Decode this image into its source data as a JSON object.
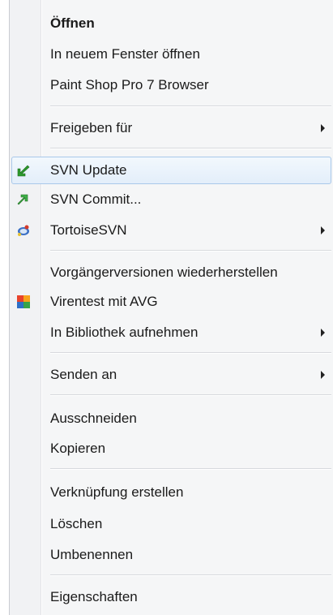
{
  "context_menu": {
    "items": [
      {
        "label": "Öffnen"
      },
      {
        "label": "In neuem Fenster öffnen"
      },
      {
        "label": "Paint Shop Pro 7 Browser"
      },
      {
        "label": "Freigeben für"
      },
      {
        "label": "SVN Update",
        "icon": "svn-update-icon"
      },
      {
        "label": "SVN Commit...",
        "icon": "svn-commit-icon"
      },
      {
        "label": "TortoiseSVN",
        "icon": "tortoisesvn-icon"
      },
      {
        "label": "Vorgängerversionen wiederherstellen"
      },
      {
        "label": "Virentest mit AVG",
        "icon": "avg-icon"
      },
      {
        "label": "In Bibliothek aufnehmen"
      },
      {
        "label": "Senden an"
      },
      {
        "label": "Ausschneiden"
      },
      {
        "label": "Kopieren"
      },
      {
        "label": "Verknüpfung erstellen"
      },
      {
        "label": "Löschen"
      },
      {
        "label": "Umbenennen"
      },
      {
        "label": "Eigenschaften"
      }
    ]
  },
  "colors": {
    "highlight_border": "#a9c8ea",
    "highlight_fill": "#e3eefa",
    "svn_green": "#2e9a2e",
    "menu_background": "#f5f6f7"
  }
}
